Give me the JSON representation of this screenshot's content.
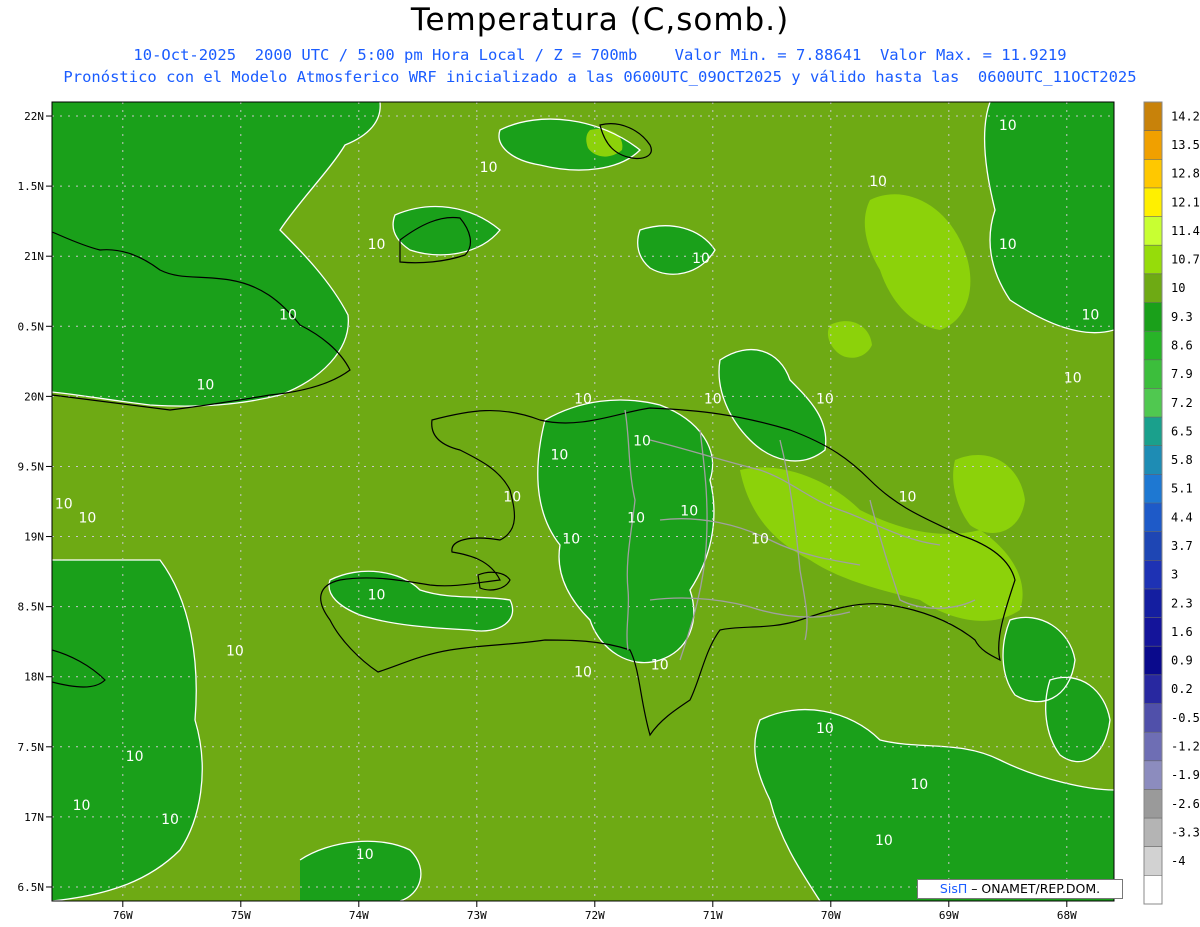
{
  "header": {
    "title": "Temperatura (C,somb.)",
    "line1": "10-Oct-2025  2000 UTC / 5:00 pm Hora Local / Z = 700mb    Valor Min. = 7.88641  Valor Max. = 11.9219",
    "line2": "Pronóstico con el Modelo Atmosferico WRF inicializado a las 0600UTC_09OCT2025 y válido hasta las  0600UTC_11OCT2025"
  },
  "axes": {
    "lat_labels": [
      "22N",
      "1.5N",
      "21N",
      "0.5N",
      "20N",
      "9.5N",
      "19N",
      "8.5N",
      "18N",
      "7.5N",
      "17N",
      "6.5N"
    ],
    "lon_labels": [
      "76W",
      "75W",
      "74W",
      "73W",
      "72W",
      "71W",
      "70W",
      "69W",
      "68W"
    ],
    "lat_values": [
      22,
      21.5,
      21,
      20.5,
      20,
      19.5,
      19,
      18.5,
      18,
      17.5,
      17,
      16.5
    ],
    "lon_values": [
      -76,
      -75,
      -74,
      -73,
      -72,
      -71,
      -70,
      -69,
      -68
    ],
    "lon_range": [
      -76.6,
      -67.6
    ],
    "lat_range": [
      16.4,
      22.1
    ],
    "grid": true
  },
  "contour_labels": {
    "value": "10",
    "positions_deg": [
      [
        -72.9,
        21.6
      ],
      [
        -69.6,
        21.5
      ],
      [
        -68.5,
        21.9
      ],
      [
        -73.85,
        21.05
      ],
      [
        -71.1,
        20.95
      ],
      [
        -68.5,
        21.05
      ],
      [
        -74.6,
        20.55
      ],
      [
        -67.8,
        20.55
      ],
      [
        -67.95,
        20.1
      ],
      [
        -75.3,
        20.05
      ],
      [
        -72.1,
        19.95
      ],
      [
        -71.0,
        19.95
      ],
      [
        -70.05,
        19.95
      ],
      [
        -71.6,
        19.65
      ],
      [
        -72.3,
        19.55
      ],
      [
        -72.7,
        19.25
      ],
      [
        -76.5,
        19.2
      ],
      [
        -76.3,
        19.1
      ],
      [
        -72.2,
        18.95
      ],
      [
        -71.65,
        19.1
      ],
      [
        -70.6,
        18.95
      ],
      [
        -71.2,
        19.15
      ],
      [
        -69.35,
        19.25
      ],
      [
        -73.85,
        18.55
      ],
      [
        -75.05,
        18.15
      ],
      [
        -72.1,
        18.0
      ],
      [
        -71.45,
        18.05
      ],
      [
        -70.05,
        17.6
      ],
      [
        -75.9,
        17.4
      ],
      [
        -69.25,
        17.2
      ],
      [
        -75.6,
        16.95
      ],
      [
        -73.95,
        16.7
      ],
      [
        -76.35,
        17.05
      ],
      [
        -69.55,
        16.8
      ]
    ]
  },
  "colorbar": {
    "labels": [
      "14.2",
      "13.5",
      "12.8",
      "12.1",
      "11.4",
      "10.7",
      "10",
      "9.3",
      "8.6",
      "7.9",
      "7.2",
      "6.5",
      "5.8",
      "5.1",
      "4.4",
      "3.7",
      "3",
      "2.3",
      "1.6",
      "0.9",
      "0.2",
      "-0.5",
      "-1.2",
      "-1.9",
      "-2.6",
      "-3.3",
      "-4"
    ],
    "colors": [
      "#c8820a",
      "#f0a000",
      "#ffc800",
      "#fff000",
      "#c8ff32",
      "#96dc0a",
      "#6eaa14",
      "#1aa01a",
      "#28b428",
      "#3cbe3c",
      "#50c850",
      "#1aa08c",
      "#1e8cb4",
      "#1e78d2",
      "#1e5ac8",
      "#1e46b4",
      "#1e32b4",
      "#141ea0",
      "#14149a",
      "#0a0a8c",
      "#2828a0",
      "#5050aa",
      "#6e6eb4",
      "#8c8cbe",
      "#9a9a9a",
      "#b4b4b4",
      "#d2d2d2",
      "#ffffff"
    ]
  },
  "map_colors": {
    "base": "#6eaa14",
    "warm": "#8cd20a",
    "cool": "#1aa01a",
    "contour": "#ffffff",
    "coast": "#000000",
    "border": "#a0a0a0",
    "grid": "#c8c8c8"
  },
  "credit": {
    "logo": "SisΠ",
    "text": " – ONAMET/REP.DOM."
  }
}
